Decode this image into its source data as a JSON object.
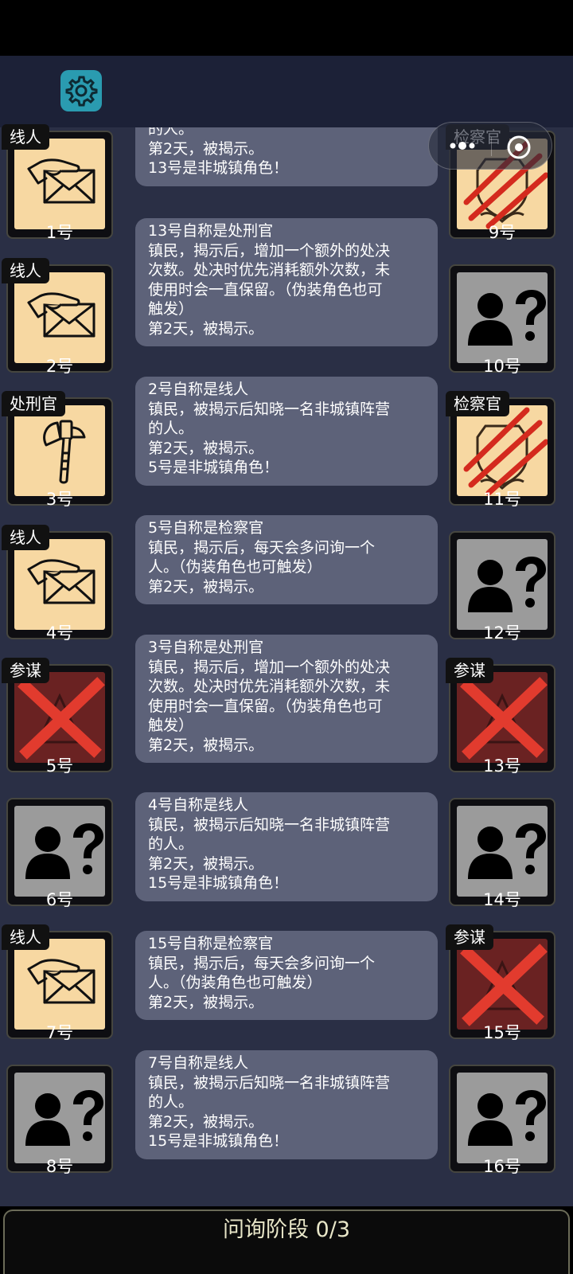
{
  "system": {
    "more_icon": "more-dots-icon",
    "close_icon": "close-circle-icon"
  },
  "settings": {
    "icon": "gear-icon"
  },
  "left_players": [
    {
      "number": "1号",
      "role": "线人",
      "state": "known",
      "art": "envelope-hand"
    },
    {
      "number": "2号",
      "role": "线人",
      "state": "known",
      "art": "envelope-hand"
    },
    {
      "number": "3号",
      "role": "处刑官",
      "state": "known",
      "art": "axe"
    },
    {
      "number": "4号",
      "role": "线人",
      "state": "known",
      "art": "envelope-hand"
    },
    {
      "number": "5号",
      "role": "参谋",
      "state": "enemy",
      "art": "red-x"
    },
    {
      "number": "6号",
      "role": "",
      "state": "unknown",
      "art": "unknown-person"
    },
    {
      "number": "7号",
      "role": "线人",
      "state": "known",
      "art": "envelope-hand"
    },
    {
      "number": "8号",
      "role": "",
      "state": "unknown",
      "art": "unknown-person"
    }
  ],
  "right_players": [
    {
      "number": "9号",
      "role": "检察官",
      "state": "known",
      "art": "shield-slashed"
    },
    {
      "number": "10号",
      "role": "",
      "state": "unknown",
      "art": "unknown-person"
    },
    {
      "number": "11号",
      "role": "检察官",
      "state": "known",
      "art": "shield-slashed"
    },
    {
      "number": "12号",
      "role": "",
      "state": "unknown",
      "art": "unknown-person"
    },
    {
      "number": "13号",
      "role": "参谋",
      "state": "enemy",
      "art": "red-x"
    },
    {
      "number": "14号",
      "role": "",
      "state": "unknown",
      "art": "unknown-person"
    },
    {
      "number": "15号",
      "role": "参谋",
      "state": "enemy",
      "art": "red-x"
    },
    {
      "number": "16号",
      "role": "",
      "state": "unknown",
      "art": "unknown-person"
    }
  ],
  "messages": [
    {
      "lines": [
        "的人。",
        "第2天，被揭示。",
        "13号是非城镇角色！"
      ]
    },
    {
      "lines": [
        "13号自称是处刑官",
        "镇民，揭示后，增加一个额外的处决",
        "次数。处决时优先消耗额外次数，未",
        "使用时会一直保留。（伪装角色也可",
        "触发）",
        "第2天，被揭示。"
      ]
    },
    {
      "lines": [
        "2号自称是线人",
        "镇民，被揭示后知晓一名非城镇阵营",
        "的人。",
        "第2天，被揭示。",
        "5号是非城镇角色！"
      ]
    },
    {
      "lines": [
        "5号自称是检察官",
        "镇民，揭示后，每天会多问询一个",
        "人。（伪装角色也可触发）",
        "第2天，被揭示。"
      ]
    },
    {
      "lines": [
        "3号自称是处刑官",
        "镇民，揭示后，增加一个额外的处决",
        "次数。处决时优先消耗额外次数，未",
        "使用时会一直保留。（伪装角色也可",
        "触发）",
        "第2天，被揭示。"
      ]
    },
    {
      "lines": [
        "4号自称是线人",
        "镇民，被揭示后知晓一名非城镇阵营",
        "的人。",
        "第2天，被揭示。",
        "15号是非城镇角色！"
      ]
    },
    {
      "lines": [
        "15号自称是检察官",
        "镇民，揭示后，每天会多问询一个",
        "人。（伪装角色也可触发）",
        "第2天，被揭示。"
      ]
    },
    {
      "lines": [
        "7号自称是线人",
        "镇民，被揭示后知晓一名非城镇阵营",
        "的人。",
        "第2天，被揭示。",
        "15号是非城镇角色！"
      ]
    }
  ],
  "phase": {
    "label": "问询阶段 0/3"
  }
}
